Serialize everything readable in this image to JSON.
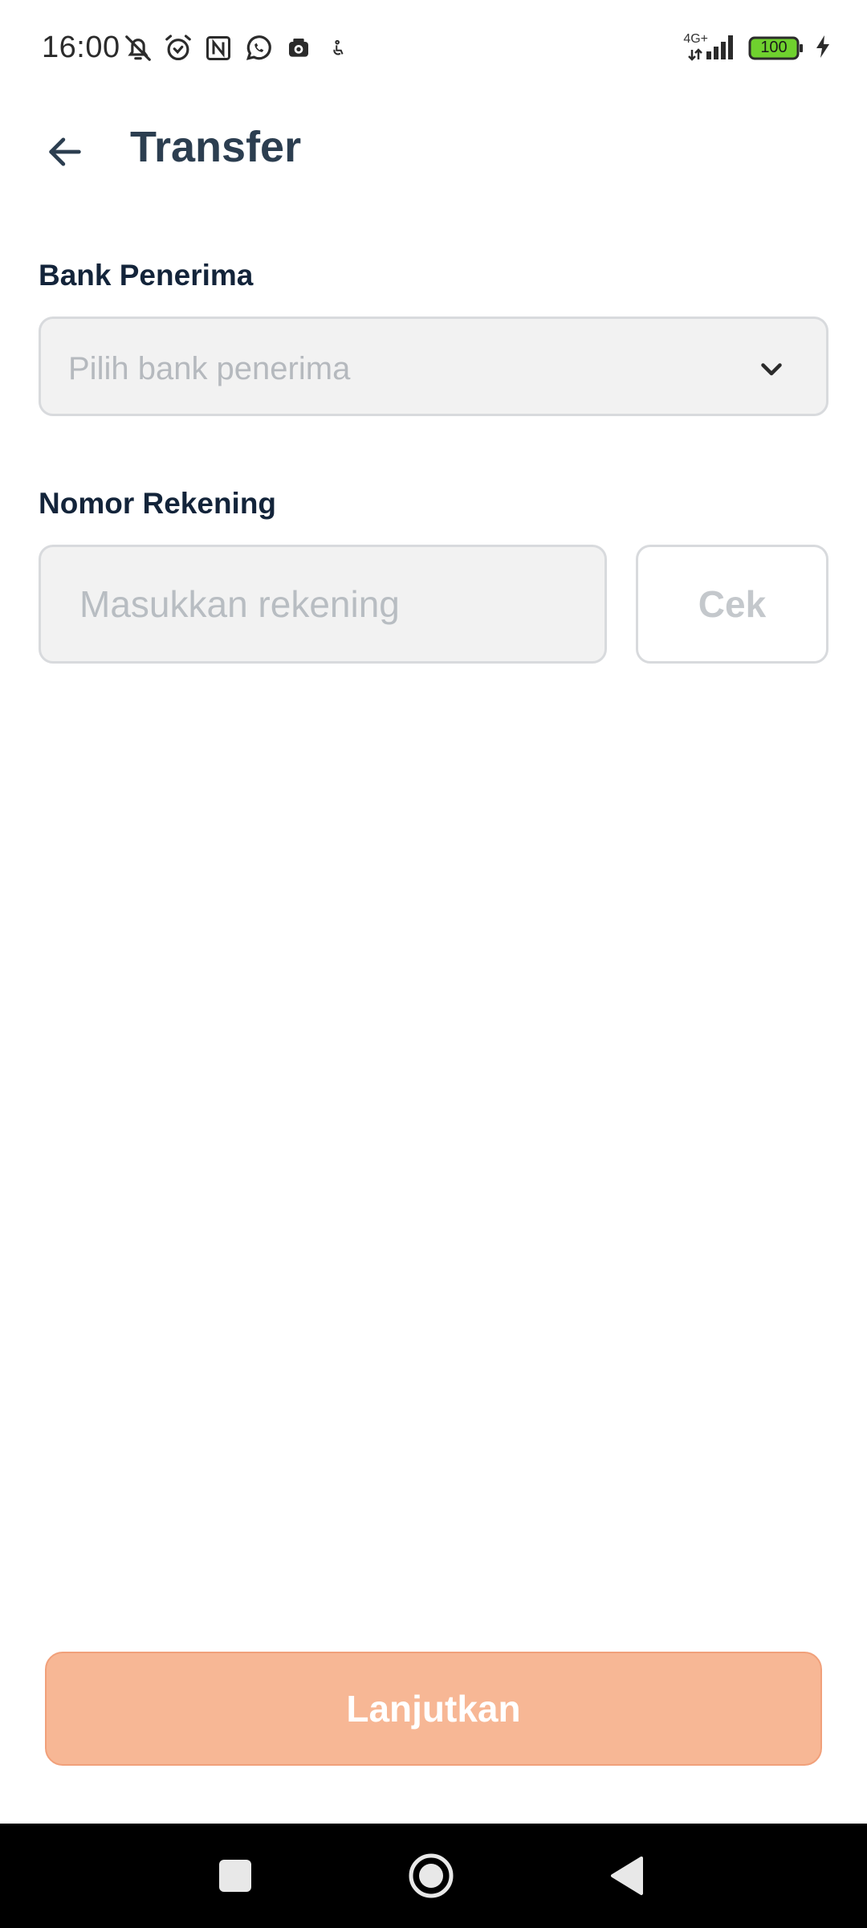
{
  "status_bar": {
    "time": "16:00",
    "network_type": "4G+",
    "battery": "100",
    "icons_left": [
      "mute-bell-icon",
      "alarm-icon",
      "nfc-icon",
      "whatsapp-icon",
      "camera-app-icon",
      "accessibility-icon"
    ],
    "icons_right": [
      "signal-icon",
      "battery-icon",
      "charging-icon"
    ]
  },
  "header": {
    "back_icon": "arrow-left-icon",
    "title": "Transfer"
  },
  "form": {
    "bank_label": "Bank Penerima",
    "bank_placeholder": "Pilih bank penerima",
    "bank_dropdown_icon": "chevron-down-icon",
    "account_label": "Nomor Rekening",
    "account_placeholder": "Masukkan rekening",
    "account_value": "",
    "check_button_label": "Cek"
  },
  "footer": {
    "continue_label": "Lanjutkan"
  },
  "colors": {
    "primary_disabled": "#f7b795",
    "field_background": "#f2f2f2",
    "field_border": "#d8dadd",
    "title": "#2c3e50",
    "nav_bar": "#000000"
  },
  "nav_bar": {
    "buttons": [
      "recents-icon",
      "home-icon",
      "back-triangle-icon"
    ]
  }
}
